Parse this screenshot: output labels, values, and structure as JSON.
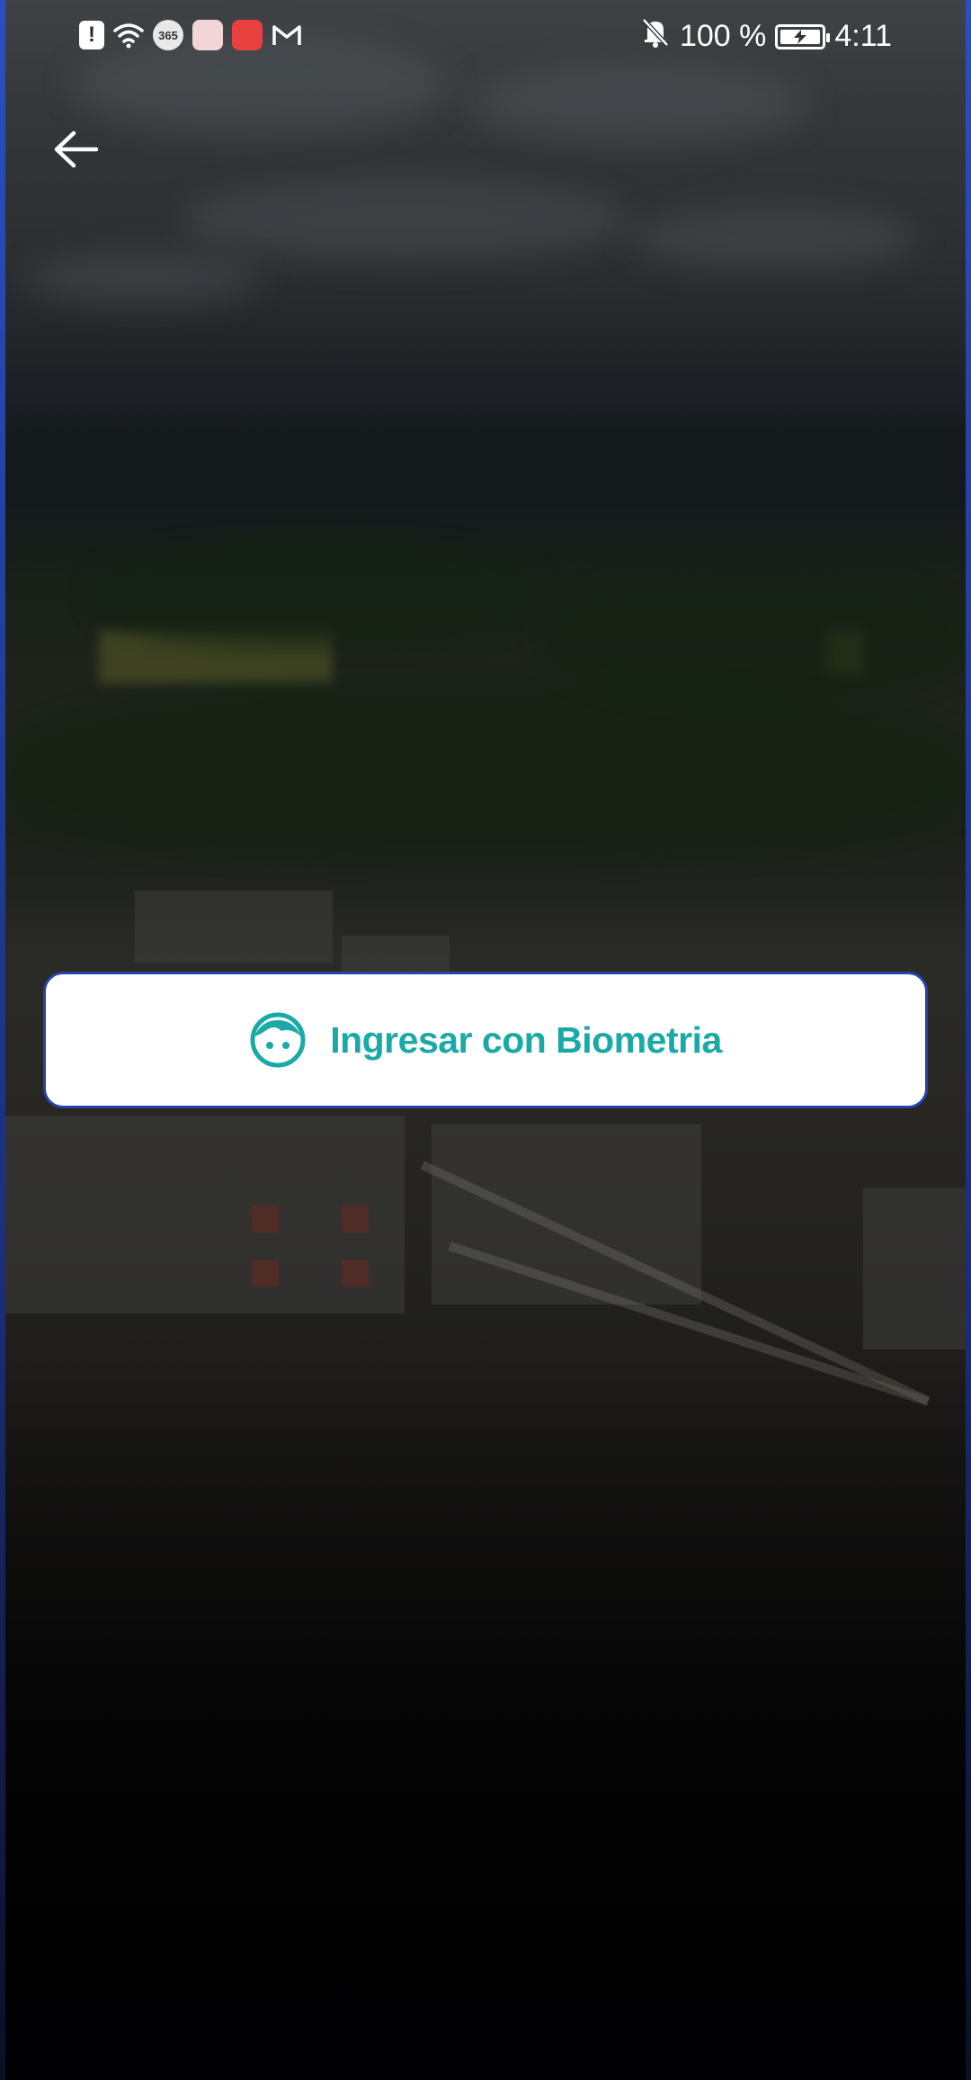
{
  "status_bar": {
    "battery_text": "100 %",
    "battery_level": 1.0,
    "time": "4:11",
    "left_icons": [
      "alert-icon",
      "wifi-icon",
      "app-365-icon",
      "package-icon",
      "huawei-app-icon",
      "gmail-icon"
    ],
    "right_icons": [
      "bell-muted-icon",
      "battery-charging-icon"
    ],
    "app_365_label": "365"
  },
  "header": {
    "back_icon": "arrow-left-icon"
  },
  "main": {
    "biometric_button": {
      "label": "Ingresar con Biometria",
      "icon": "face-icon",
      "label_color": "#1aa9a6",
      "border_color": "#2843a8"
    }
  }
}
